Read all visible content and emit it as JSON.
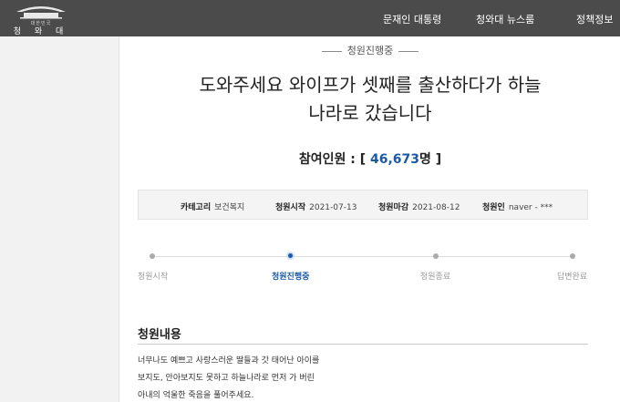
{
  "header": {
    "logo_small": "대한민국",
    "logo_name": "청 와 대",
    "nav": [
      "문재인 대통령",
      "청와대 뉴스룸",
      "정책정보"
    ]
  },
  "petition": {
    "status": "청원진행중",
    "title_lines": [
      "도와주세요 와이프가 셋째를 출산하다가 하늘",
      "나라로 갔습니다"
    ],
    "count_label": "참여인원 : [",
    "count_value": "46,673",
    "count_suffix": "명 ]",
    "meta": [
      {
        "label": "카테고리",
        "value": "보건복지"
      },
      {
        "label": "청원시작",
        "value": "2021-07-13"
      },
      {
        "label": "청원마감",
        "value": "2021-08-12"
      },
      {
        "label": "청원인",
        "value": "naver - ***"
      }
    ],
    "steps": [
      "청원시작",
      "청원진행중",
      "청원종료",
      "답변완료"
    ],
    "active_step": 1,
    "section_title": "청원내용",
    "body_lines": [
      "너무나도 예쁘고 사랑스러운 딸들과 갓 태어난 아이를",
      "보지도, 안아보지도 못하고 하늘나라로 먼저 가 버린",
      "아내의 억울한 죽음을 풀어주세요."
    ]
  },
  "colors": {
    "accent": "#1a5aa8",
    "topbar": "#4b4b4b"
  }
}
